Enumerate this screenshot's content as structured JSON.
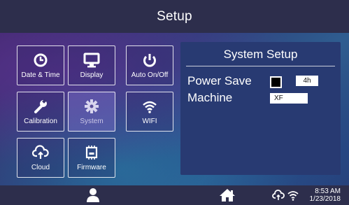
{
  "header": {
    "title": "Setup"
  },
  "tiles": [
    {
      "label": "Date & Time",
      "icon": "clock-icon"
    },
    {
      "label": "Display",
      "icon": "monitor-icon"
    },
    {
      "label": "Auto On/Off",
      "icon": "power-icon"
    },
    {
      "label": "Calibration",
      "icon": "wrench-icon"
    },
    {
      "label": "System",
      "icon": "gear-icon",
      "selected": true
    },
    {
      "label": "WIFI",
      "icon": "wifi-icon"
    },
    {
      "label": "Cloud",
      "icon": "cloud-upload-icon"
    },
    {
      "label": "Firmware",
      "icon": "chip-icon"
    }
  ],
  "panel": {
    "title": "System Setup",
    "power_save_label": "Power Save",
    "power_save_checked": false,
    "power_save_value": "4h",
    "machine_label": "Machine",
    "machine_value": "XF"
  },
  "status": {
    "time": "8:53 AM",
    "date": "1/23/2018",
    "icons": [
      "user-icon",
      "home-icon",
      "cloud-sync-icon",
      "wifi-icon"
    ]
  },
  "colors": {
    "bars": "#2d2e4c",
    "panel": "#283a72",
    "accent": "#ffffff"
  }
}
